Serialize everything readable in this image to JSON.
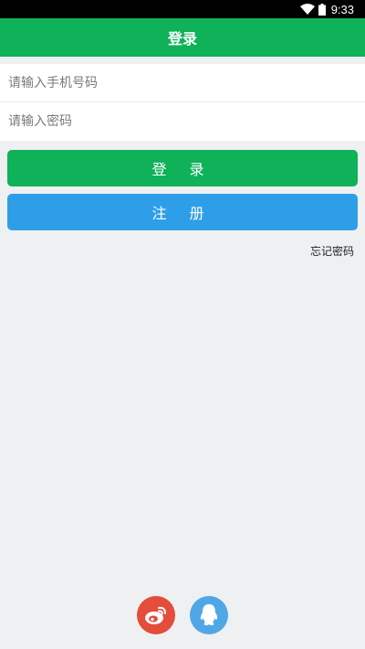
{
  "status_bar": {
    "time": "9:33"
  },
  "header": {
    "title": "登录"
  },
  "form": {
    "phone_placeholder": "请输入手机号码",
    "password_placeholder": "请输入密码"
  },
  "actions": {
    "login_label": "登 录",
    "register_label": "注 册",
    "forgot_label": "忘记密码"
  },
  "social": {
    "weibo_icon": "weibo-icon",
    "qq_icon": "qq-icon"
  },
  "colors": {
    "primary_green": "#0fb159",
    "register_blue": "#2f9ee8",
    "weibo_red": "#e44c3b",
    "qq_blue": "#4fa7e6",
    "background": "#eff0f2"
  }
}
